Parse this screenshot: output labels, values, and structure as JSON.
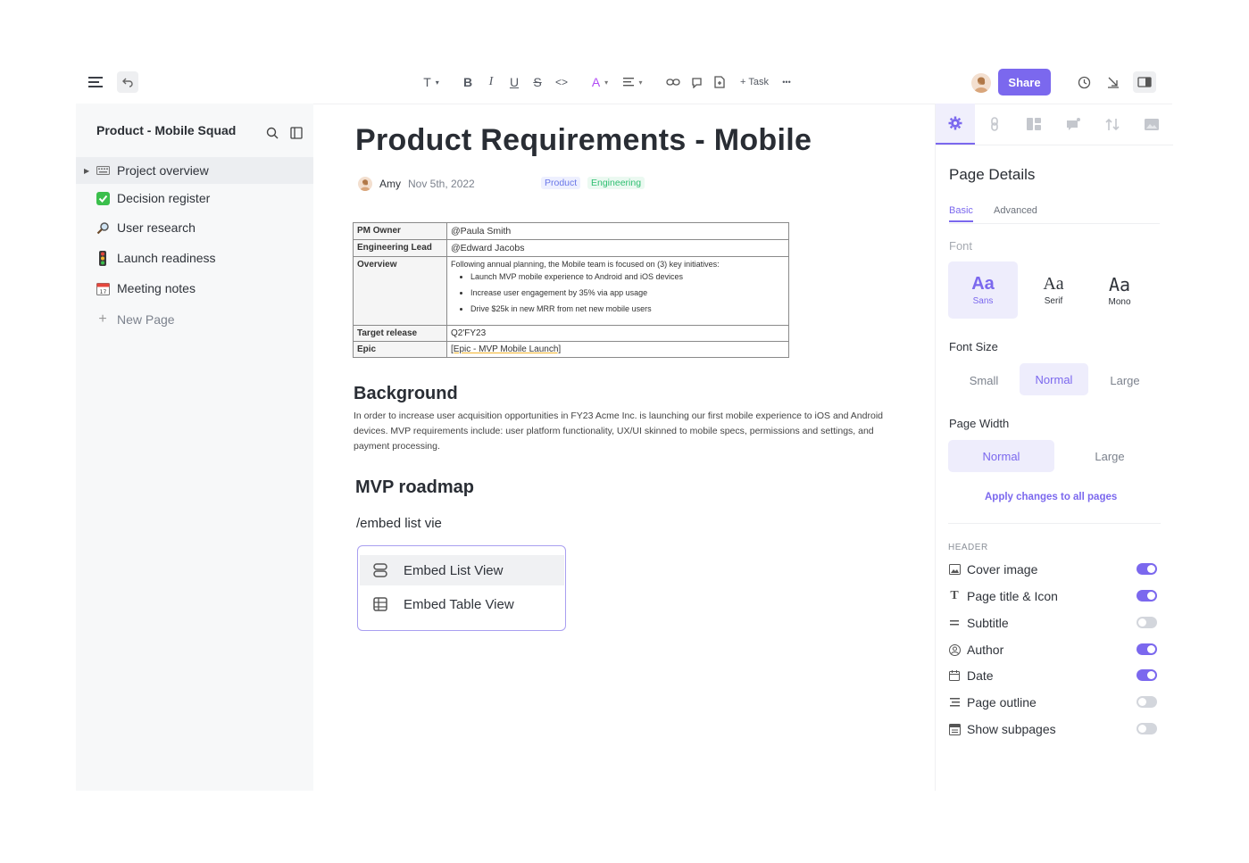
{
  "toolbar": {
    "text_style": "T",
    "bold": "B",
    "italic": "I",
    "underline": "U",
    "strike": "S",
    "code": "<>",
    "color": "A",
    "task_label": "+ Task",
    "more": "•••",
    "share_label": "Share",
    "accent": "#7b68ee"
  },
  "sidebar": {
    "title": "Product - Mobile Squad",
    "items": [
      {
        "label": "Project overview",
        "icon": "keyboard-icon"
      },
      {
        "label": "Decision register",
        "icon": "check-box-icon"
      },
      {
        "label": "User research",
        "icon": "magnifier-icon"
      },
      {
        "label": "Launch readiness",
        "icon": "traffic-light-icon"
      },
      {
        "label": "Meeting notes",
        "icon": "calendar-icon"
      },
      {
        "label": "New Page",
        "icon": "plus-icon"
      }
    ]
  },
  "doc": {
    "title": "Product Requirements - Mobile",
    "author": "Amy",
    "date": "Nov 5th, 2022",
    "tags": [
      "Product",
      "Engineering"
    ],
    "table": {
      "pm_owner_key": "PM Owner",
      "pm_owner_val": "@Paula Smith",
      "eng_lead_key": "Engineering Lead",
      "eng_lead_val": "@Edward Jacobs",
      "overview_key": "Overview",
      "overview_intro": "Following annual planning, the Mobile team is focused on (3) key initiatives:",
      "bullets": [
        "Launch MVP mobile experience to Android and iOS devices",
        "Increase user engagement by 35% via app usage",
        "Drive $25k in new MRR from net new mobile users"
      ],
      "target_key": "Target release",
      "target_val": "Q2'FY23",
      "epic_key": "Epic",
      "epic_val": "[Epic - MVP Mobile Launch]"
    },
    "background_heading": "Background",
    "background_text": "In order to increase user acquisition opportunities in FY23 Acme Inc. is launching our first mobile experience to iOS and Android devices. MVP requirements include: user platform functionality, UX/UI skinned to mobile specs, permissions and settings, and payment processing.",
    "roadmap_heading": "MVP roadmap",
    "slash_command": "/embed list vie",
    "menu": [
      "Embed List View",
      "Embed Table View"
    ]
  },
  "panel": {
    "heading": "Page Details",
    "tabs": [
      "Basic",
      "Advanced"
    ],
    "font_label": "Font",
    "fonts": [
      {
        "aa": "Aa",
        "name": "Sans"
      },
      {
        "aa": "Aa",
        "name": "Serif"
      },
      {
        "aa": "Aa",
        "name": "Mono"
      }
    ],
    "font_size_label": "Font Size",
    "font_sizes": [
      "Small",
      "Normal",
      "Large"
    ],
    "page_width_label": "Page Width",
    "page_widths": [
      "Normal",
      "Large"
    ],
    "apply_label": "Apply changes to all pages",
    "header_label": "HEADER",
    "toggles": [
      {
        "label": "Cover image",
        "on": true
      },
      {
        "label": "Page title & Icon",
        "on": true
      },
      {
        "label": "Subtitle",
        "on": false
      },
      {
        "label": "Author",
        "on": true
      },
      {
        "label": "Date",
        "on": true
      },
      {
        "label": "Page outline",
        "on": false
      },
      {
        "label": "Show subpages",
        "on": false
      }
    ]
  }
}
